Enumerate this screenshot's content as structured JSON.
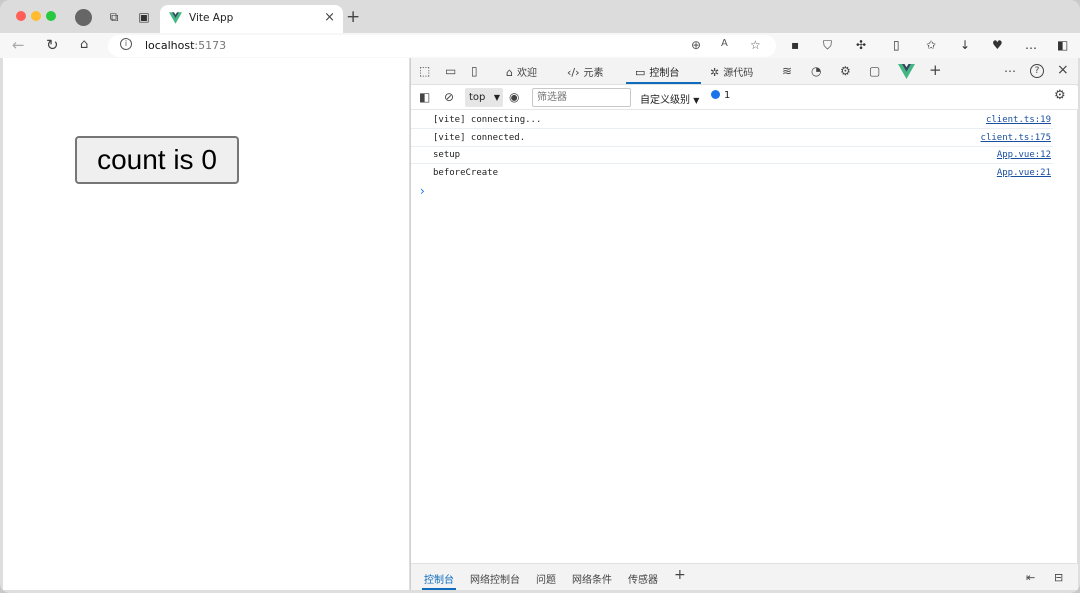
{
  "browser": {
    "tab_title": "Vite App",
    "url_host": "localhost",
    "url_port": ":5173",
    "colors": {
      "close": "#ff5f57",
      "minimize": "#febc2e",
      "maximize": "#28c840",
      "vue_green": "#41b883",
      "accent": "#0f6cbd"
    }
  },
  "page": {
    "count_button_label": "count is 0"
  },
  "devtools": {
    "tabs": [
      "欢迎",
      "元素",
      "控制台",
      "源代码"
    ],
    "toolbar": {
      "context": "top",
      "filter_placeholder": "筛选器",
      "levels": "自定义级别",
      "message_count": "1"
    },
    "console_rows": [
      {
        "message": "[vite] connecting...",
        "source": "client.ts:19"
      },
      {
        "message": "[vite] connected.",
        "source": "client.ts:175"
      },
      {
        "message": "setup",
        "source": "App.vue:12"
      },
      {
        "message": "beforeCreate",
        "source": "App.vue:21"
      }
    ],
    "prompt_symbol": "›",
    "drawer_tabs": [
      "控制台",
      "网络控制台",
      "问题",
      "网络条件",
      "传感器"
    ]
  }
}
